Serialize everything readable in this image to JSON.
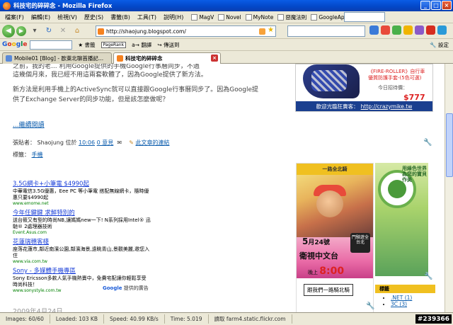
{
  "window": {
    "title": "科技宅的碎碎念 - Mozilla Firefox",
    "controls": [
      "_",
      "□",
      "×"
    ]
  },
  "menubar": {
    "items": [
      "檔案(F)",
      "編輯(E)",
      "檢視(V)",
      "歷史(S)",
      "書籤(B)",
      "工具(T)",
      "說明(H)"
    ],
    "bookmarks": [
      "MagV",
      "Novel",
      "MyNote",
      "惡魔法則",
      "GoogleApp"
    ]
  },
  "navbar": {
    "url": "http://shaojung.blogspot.com/"
  },
  "googlebar": {
    "logo": "Google",
    "items": [
      "書籤",
      "PageRank",
      "翻譯",
      "傳送到"
    ],
    "settings": "設定"
  },
  "tabs": [
    {
      "label": "Mobile01 [Blog] - 歐萊北聊首播記...",
      "active": false
    },
    {
      "label": "科技宅的碎碎念",
      "active": true
    }
  ],
  "post": {
    "line1": "之前，我的老... 利用Google提供的手機Google行事曆同步，不過",
    "line2": "這幾個月來，我已經不用這兩套軟體了，因為Google提供了新方法。",
    "para2a": "新方法是利用手機上的ActiveSync就可以直接跟Google行事曆同步了。因為Google提",
    "para2b": "供了Exchange Server的同步功能，但是該怎麼做呢？",
    "read_more": "...繼續閱讀",
    "author_label": "張貼者：",
    "author": "Shaojung",
    "at": "位於",
    "time": "10:06",
    "comments": "0 意見",
    "links": "此文章的連結",
    "tags_label": "標籤：",
    "tag": "手機",
    "date": "2009年4月24日"
  },
  "ads": [
    {
      "title": "3.5G網卡+小筆電 $4990起",
      "desc": "中華電信3.5G優惠，Eee PC 等小筆電 搭配無線網卡，隨時優惠只要$4990起",
      "url": "www.emome.net"
    },
    {
      "title": "今年任鍵鍵 求鮮特別的",
      "desc": "送台筱又有型的時尚NB,讓媽媽new一下! N系列採用Intel® 迅馳® 2處理器技術",
      "url": "Event.Asus.com"
    },
    {
      "title": "花蓮瑞穗客棧",
      "desc": "座落花蓮市,鄰近南濱公園,鄰濱海景,遠眺青山,景觀美麗,邀您入住",
      "url": "www.via.com.tw"
    },
    {
      "title": "Sony - 多媒體手機專區",
      "desc": "Sony Ericsson多款人氣手機熱賣中，免費宅配讓你輕鬆享受時尚科技！",
      "url": "www.sonystyle.com.tw"
    }
  ],
  "ads_by": {
    "prefix": "Google",
    "suffix": "提供的廣告"
  },
  "sidebar": {
    "ad_title": "《FIRE-ROLLER》自行車優質防護手套-(5色可選)",
    "ad_sub": "今日招待價：",
    "ad_price": "$777",
    "ad_bar": "歡迎光臨狂賣客：",
    "ad_bar_link": "http://crazymike.tw",
    "banner1_head": "一路全北騎",
    "banner1_date_num": "5",
    "banner1_date_rest": "月24號",
    "banner1_stamp": "門騎遊全台北",
    "banner1_big": "衛視中文台",
    "banner1_time_pre": "晚上",
    "banner1_time": "8:00",
    "banner1_btn": "跟我們一路騎北騎",
    "banner2_text": "用綠色世界為您的寶貝作美",
    "tag_head": "標籤",
    "tags": [
      ".NET (1)",
      "3C (3)"
    ]
  },
  "statusbar": {
    "images": "Images: 60/60",
    "loaded": "Loaded: 103 KB",
    "speed": "Speed: 40.99 KB/s",
    "time": "Time: 5.019",
    "reading": "讀取 farm4.static.flickr.com",
    "counter": "#239366"
  }
}
